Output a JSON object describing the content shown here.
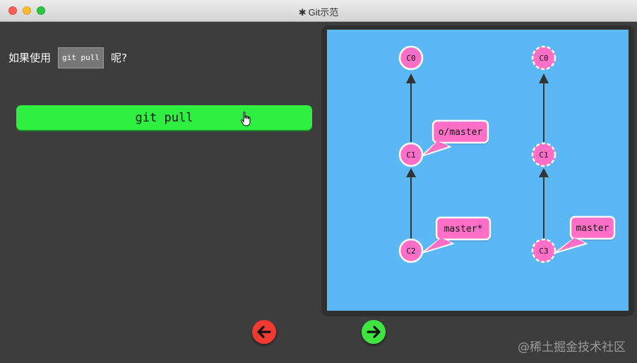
{
  "window": {
    "title": "Git示范",
    "title_icon": "gear-icon"
  },
  "question": {
    "prefix": "如果使用",
    "code": "git pull",
    "suffix": "呢?"
  },
  "command_button": {
    "label": "git pull"
  },
  "graph": {
    "left": {
      "commits": [
        {
          "id": "C0",
          "style": "solid"
        },
        {
          "id": "C1",
          "style": "solid"
        },
        {
          "id": "C2",
          "style": "solid"
        }
      ],
      "labels": [
        {
          "text": "o/master",
          "target": "C1"
        },
        {
          "text": "master*",
          "target": "C2"
        }
      ]
    },
    "right": {
      "commits": [
        {
          "id": "C0",
          "style": "dashed"
        },
        {
          "id": "C1",
          "style": "dashed"
        },
        {
          "id": "C3",
          "style": "dashed"
        }
      ],
      "labels": [
        {
          "text": "master",
          "target": "C3"
        }
      ]
    }
  },
  "nav": {
    "back_icon": "arrow-left-icon",
    "forward_icon": "arrow-right-icon"
  },
  "watermark": "@稀土掘金技术社区",
  "colors": {
    "canvas": "#5cb8f5",
    "commit": "#ff6ec7",
    "command_button": "#2ef041",
    "back_button": "#f03b32",
    "forward_button": "#3fe441"
  }
}
